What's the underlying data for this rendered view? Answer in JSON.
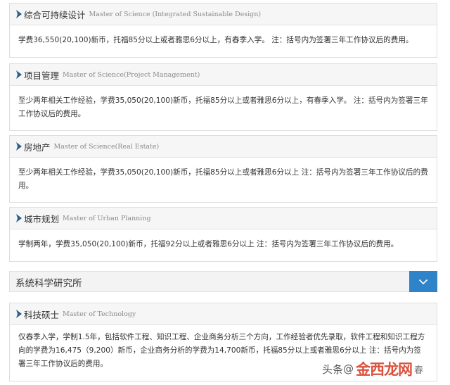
{
  "programs": [
    {
      "title_zh": "综合可持续设计",
      "title_en": "Master of Science (Integrated Sustainable Design)",
      "text": "学费36,550(20,100)新币，托福85分以上或者雅思6分以上，有春季入学。 注：括号内为签署三年工作协议后的费用。"
    },
    {
      "title_zh": "项目管理",
      "title_en": "Master of Science(Project Management)",
      "text": "至少两年相关工作经验，学费35,050(20,100)新币，托福85分以上或者雅思6分以上，有春季入学。 注：括号内为签署三年工作协议后的费用。"
    },
    {
      "title_zh": "房地产",
      "title_en": "Master of Science(Real Estate)",
      "text": "至少两年相关工作经验，学费35,050(20,100)新币，托福85分以上或者雅思6分以上 注：括号内为签署三年工作协议后的费用。"
    },
    {
      "title_zh": "城市规划",
      "title_en": "Master of Urban Planning",
      "text": "学制两年，学费35,050(20,100)新币，托福92分以上或者雅思6分以上 注：括号内为签署三年工作协议后的费用。"
    }
  ],
  "section": {
    "title": "系统科学研究所",
    "toggle_icon": "chevron-down-icon",
    "accent_color": "#2f83c8"
  },
  "tech_program": {
    "title_zh": "科技硕士",
    "title_en": "Master of Technology",
    "text": "仅春季入学，学制1.5年，包括软件工程、知识工程、企业商务分析三个方向，工作经验者优先录取，软件工程和知识工程方向的学费为16,475（9,200）新币，企业商务分析的学费为14,700新币，托福85分以上或者雅思6分以上 注：括号内为签署三年工作协议后的费用。"
  },
  "watermark": {
    "prefix": "头条",
    "at": "@",
    "logo": "金西龙网",
    "suffix": "春"
  }
}
